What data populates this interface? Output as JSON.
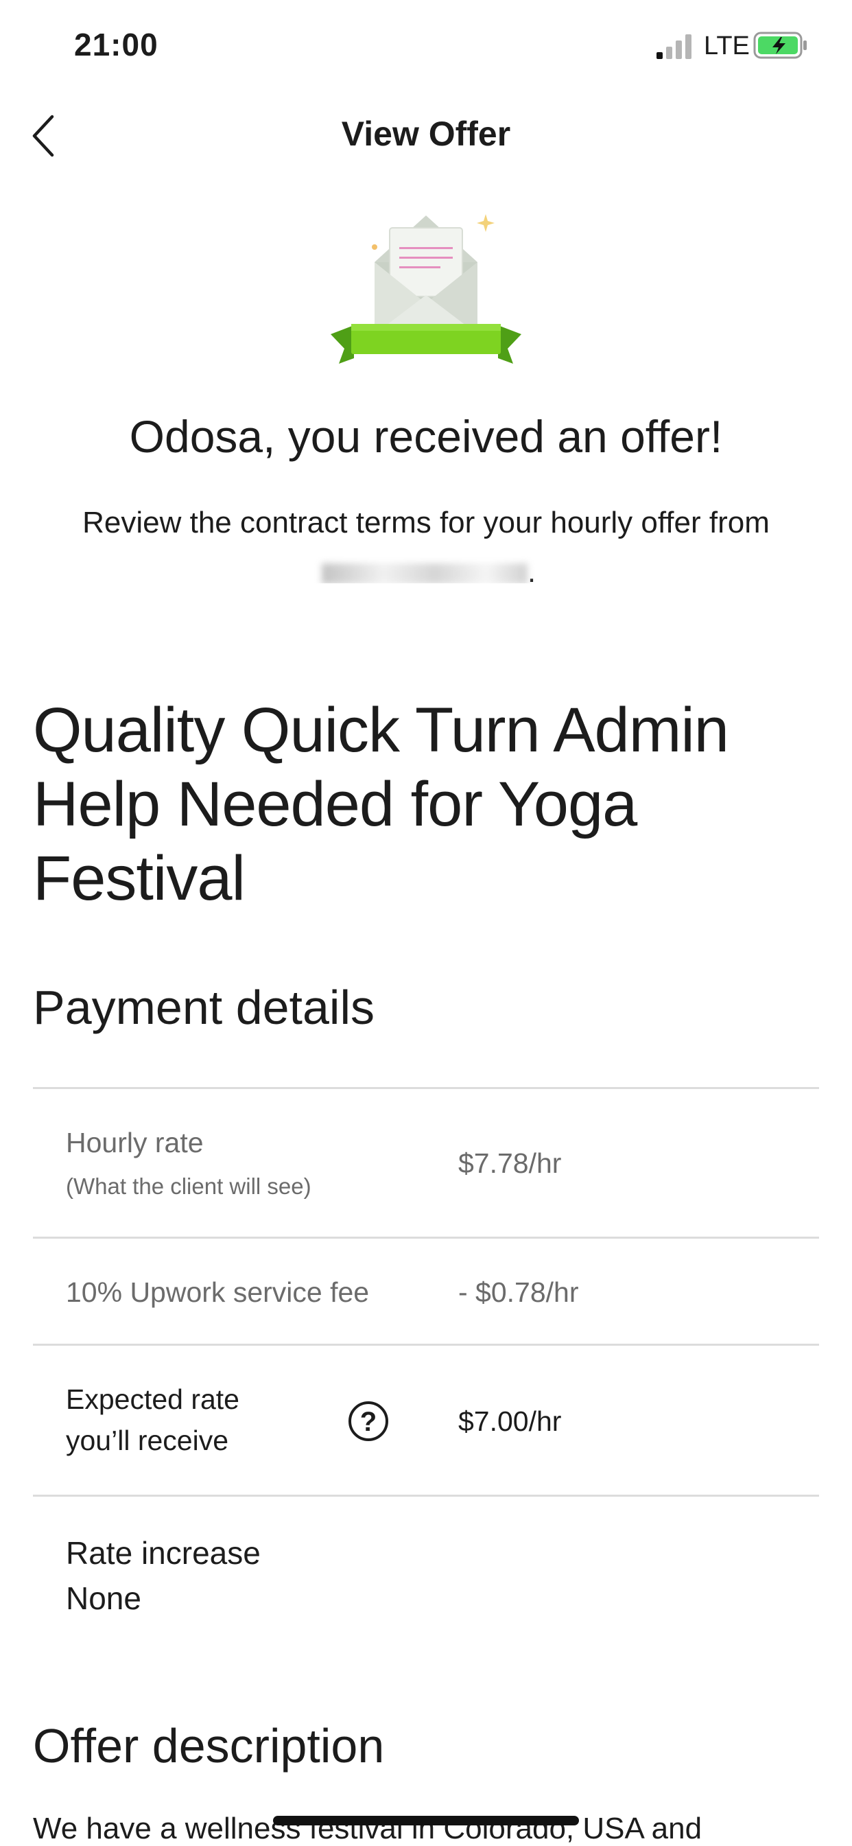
{
  "status_bar": {
    "time": "21:00",
    "network": "LTE"
  },
  "nav": {
    "title": "View Offer",
    "back_icon": "chevron-left-icon"
  },
  "hero": {
    "illustration": "envelope-letter-ribbon-icon",
    "title": "Odosa, you received an offer!",
    "subtitle": "Review the contract terms for your hourly offer from",
    "subtitle_end": "."
  },
  "job": {
    "title": "Quality Quick Turn Admin Help Needed for Yoga Festival"
  },
  "payment": {
    "heading": "Payment details",
    "hourly_rate_label": "Hourly rate",
    "hourly_rate_note": "(What the client will see)",
    "hourly_rate_value": "$7.78/hr",
    "fee_label": "10% Upwork service fee",
    "fee_value": "- $0.78/hr",
    "expected_label_line1": "Expected rate",
    "expected_label_line2": "you’ll receive",
    "expected_help_icon": "question-circle-icon",
    "expected_help_glyph": "?",
    "expected_value": "$7.00/hr",
    "rate_increase_label": "Rate increase",
    "rate_increase_value": "None"
  },
  "offer": {
    "heading": "Offer description",
    "description_start": "We have a wellness festival in Colorado, USA and"
  },
  "colors": {
    "ribbon_green": "#7ed321",
    "text": "#1c1c1c",
    "muted": "#6b6b6b",
    "divider": "#dcdcdc"
  }
}
